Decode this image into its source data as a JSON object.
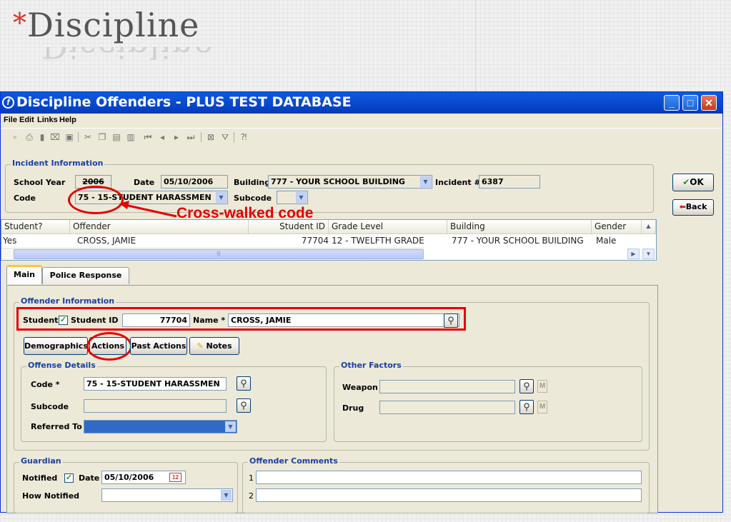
{
  "slide": {
    "star": "*",
    "title": "Discipline"
  },
  "window": {
    "title": "Discipline Offenders - PLUS TEST DATABASE",
    "menu": [
      "File",
      "Edit",
      "Links",
      "Help"
    ],
    "controls": {
      "minimize": "_",
      "maximize": "□",
      "close": "✕"
    }
  },
  "toolbar": {
    "icons": [
      "new-icon",
      "print-icon",
      "delete-icon",
      "open-icon",
      "save-icon",
      "cut-icon",
      "copy-icon",
      "paste-icon",
      "clipboard-icon",
      "first-record-icon",
      "prev-record-icon",
      "next-record-icon",
      "last-record-icon",
      "report-icon",
      "filter-icon",
      "help-pointer-icon"
    ]
  },
  "incident": {
    "group_label": "Incident Information",
    "school_year_label": "School Year",
    "school_year": "2006",
    "date_label": "Date",
    "date": "05/10/2006",
    "building_label": "Building",
    "building": "777 - YOUR SCHOOL BUILDING",
    "incident_label": "Incident #",
    "incident_no": "6387",
    "code_label": "Code",
    "code": "75 - 15-STUDENT HARASSMEN",
    "subcode_label": "Subcode",
    "subcode": ""
  },
  "annotation": {
    "text": "Cross-walked code",
    "color": "#e60000"
  },
  "side_buttons": {
    "ok": "OK",
    "back": "Back"
  },
  "offenders_table": {
    "headers": [
      "Student?",
      "Offender",
      "Student ID",
      "Grade Level",
      "Building",
      "Gender"
    ],
    "rows": [
      {
        "student": "Yes",
        "offender": "CROSS, JAMIE",
        "student_id": "77704",
        "grade": "12 - TWELFTH GRADE",
        "building": "777 - YOUR SCHOOL BUILDING",
        "gender": "Male"
      }
    ]
  },
  "tabs": [
    "Main",
    "Police Response"
  ],
  "offender_info": {
    "group_label": "Offender Information",
    "student_label": "Student",
    "student_checked": true,
    "student_id_label": "Student ID",
    "student_id": "77704",
    "name_label": "Name *",
    "name": "CROSS, JAMIE",
    "buttons": {
      "demographics": "Demographics",
      "actions": "Actions",
      "past_actions": "Past Actions",
      "notes": "Notes"
    }
  },
  "offense_details": {
    "group_label": "Offense Details",
    "code_label": "Code *",
    "code": "75 - 15-STUDENT HARASSMEN",
    "subcode_label": "Subcode",
    "subcode": "",
    "referred_label": "Referred To",
    "referred": ""
  },
  "other_factors": {
    "group_label": "Other Factors",
    "weapon_label": "Weapon",
    "weapon": "",
    "drug_label": "Drug",
    "drug": "",
    "m_label": "M"
  },
  "guardian": {
    "group_label": "Guardian",
    "notified_label": "Notified",
    "notified_checked": true,
    "date_label": "Date",
    "date": "05/10/2006",
    "how_label": "How Notified",
    "how": ""
  },
  "comments": {
    "group_label": "Offender Comments",
    "line1_no": "1",
    "line1": "",
    "line2_no": "2",
    "line2": ""
  }
}
